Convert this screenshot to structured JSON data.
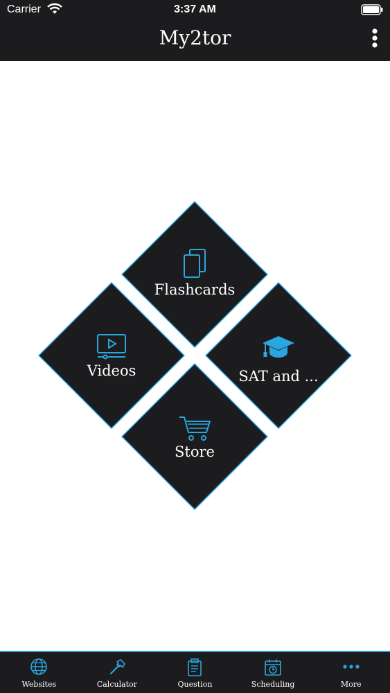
{
  "status": {
    "carrier": "Carrier",
    "time": "3:37 AM"
  },
  "header": {
    "title": "My2tor",
    "menu_icon": "more-vertical-icon"
  },
  "tiles": [
    {
      "label": "Flashcards",
      "icon": "cards-icon"
    },
    {
      "label": "Videos",
      "icon": "video-icon"
    },
    {
      "label": "SAT and ...",
      "icon": "graduation-cap-icon"
    },
    {
      "label": "Store",
      "icon": "cart-icon"
    }
  ],
  "tabbar": [
    {
      "label": "Websites",
      "icon": "globe-icon"
    },
    {
      "label": "Calculator",
      "icon": "hammer-icon"
    },
    {
      "label": "Question",
      "icon": "document-icon"
    },
    {
      "label": "Scheduling",
      "icon": "calendar-clock-icon"
    },
    {
      "label": "More",
      "icon": "more-horizontal-icon"
    }
  ],
  "colors": {
    "accent": "#2aa6e0",
    "dark": "#1c1c1e",
    "background": "#ffffff"
  }
}
